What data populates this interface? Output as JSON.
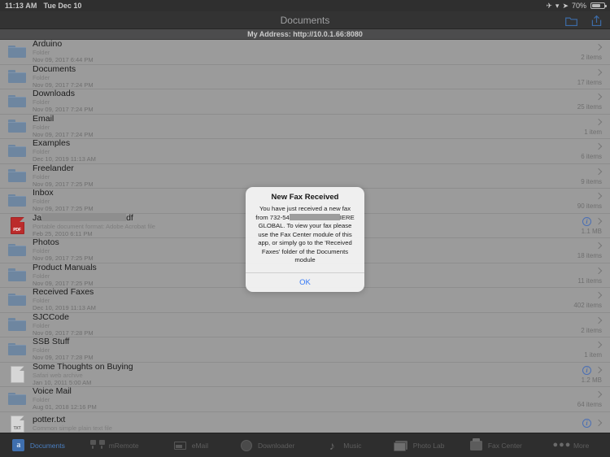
{
  "statusbar": {
    "time": "11:13 AM",
    "date": "Tue Dec 10",
    "airplane_icon": "airplane-icon",
    "wifi_icon": "wifi-icon",
    "location_icon": "location-arrow-icon",
    "battery_percent": "70%"
  },
  "navbar": {
    "title": "Documents",
    "new_folder_icon": "new-folder-icon",
    "share_icon": "share-upload-icon"
  },
  "addressbar": {
    "text": "My Address: http://10.0.1.66:8080"
  },
  "files": [
    {
      "name": "Arduino",
      "kind": "Folder",
      "date": "Nov 09, 2017 6:44 PM",
      "meta": "2 items",
      "icon": "folder",
      "info": false
    },
    {
      "name": "Documents",
      "kind": "Folder",
      "date": "Nov 09, 2017 7:24 PM",
      "meta": "17 items",
      "icon": "folder",
      "info": false
    },
    {
      "name": "Downloads",
      "kind": "Folder",
      "date": "Nov 09, 2017 7:24 PM",
      "meta": "25 items",
      "icon": "folder",
      "info": false
    },
    {
      "name": "Email",
      "kind": "Folder",
      "date": "Nov 09, 2017 7:24 PM",
      "meta": "1 item",
      "icon": "folder",
      "info": false
    },
    {
      "name": "Examples",
      "kind": "Folder",
      "date": "Dec 10, 2019 11:13 AM",
      "meta": "6 items",
      "icon": "folder",
      "info": false
    },
    {
      "name": "Freelander",
      "kind": "Folder",
      "date": "Nov 09, 2017 7:25 PM",
      "meta": "9 items",
      "icon": "folder",
      "info": false
    },
    {
      "name": "Inbox",
      "kind": "Folder",
      "date": "Nov 09, 2017 7:25 PM",
      "meta": "90 items",
      "icon": "folder",
      "info": false
    },
    {
      "name": "Ja",
      "name_suffix": "df",
      "redacted_name": true,
      "kind": "Portable document format: Adobe Acrobat file",
      "date": "Feb 25, 2010 6:11 PM",
      "meta": "1.1 MB",
      "icon": "pdf",
      "info": true,
      "icon_label": "PDF"
    },
    {
      "name": "Photos",
      "kind": "Folder",
      "date": "Nov 09, 2017 7:25 PM",
      "meta": "18 items",
      "icon": "folder",
      "info": false
    },
    {
      "name": "Product Manuals",
      "kind": "Folder",
      "date": "Nov 09, 2017 7:25 PM",
      "meta": "11 items",
      "icon": "folder",
      "info": false
    },
    {
      "name": "Received Faxes",
      "kind": "Folder",
      "date": "Dec 10, 2019 11:13 AM",
      "meta": "402 items",
      "icon": "folder",
      "info": false
    },
    {
      "name": "SJCCode",
      "kind": "Folder",
      "date": "Nov 09, 2017 7:28 PM",
      "meta": "2 items",
      "icon": "folder",
      "info": false
    },
    {
      "name": "SSB Stuff",
      "kind": "Folder",
      "date": "Nov 09, 2017 7:28 PM",
      "meta": "1 item",
      "icon": "folder",
      "info": false
    },
    {
      "name": "Some Thoughts on Buying",
      "kind": "Safari web archive",
      "date": "Jan 10, 2011 5:00 AM",
      "meta": "1.2 MB",
      "icon": "doc",
      "info": true
    },
    {
      "name": "Voice Mail",
      "kind": "Folder",
      "date": "Aug 01, 2018 12:16 PM",
      "meta": "64 items",
      "icon": "folder",
      "info": false
    },
    {
      "name": "potter.txt",
      "kind": "Common simple plain text file",
      "date": "",
      "meta": "",
      "icon": "txt",
      "info": true,
      "icon_label": "TXT"
    }
  ],
  "alert": {
    "title": "New Fax Received",
    "message_part1": "You have just received a new fax from 732-54",
    "message_part2": "IERE GLOBAL. To view your fax please use the Fax Center module of this app, or simply go to the 'Received Faxes' folder of the Documents module",
    "ok_label": "OK",
    "accent_color": "#3478f6"
  },
  "tabbar": {
    "tabs": [
      {
        "label": "Documents",
        "icon": "documents-icon",
        "active": true
      },
      {
        "label": "mRemote",
        "icon": "remote-icon",
        "active": false
      },
      {
        "label": "eMail",
        "icon": "mail-icon",
        "active": false
      },
      {
        "label": "Downloader",
        "icon": "download-icon",
        "active": false
      },
      {
        "label": "Music",
        "icon": "music-note-icon",
        "active": false
      },
      {
        "label": "Photo Lab",
        "icon": "photo-icon",
        "active": false
      },
      {
        "label": "Fax Center",
        "icon": "fax-icon",
        "active": false
      },
      {
        "label": "More",
        "icon": "more-dots-icon",
        "active": false
      }
    ]
  }
}
